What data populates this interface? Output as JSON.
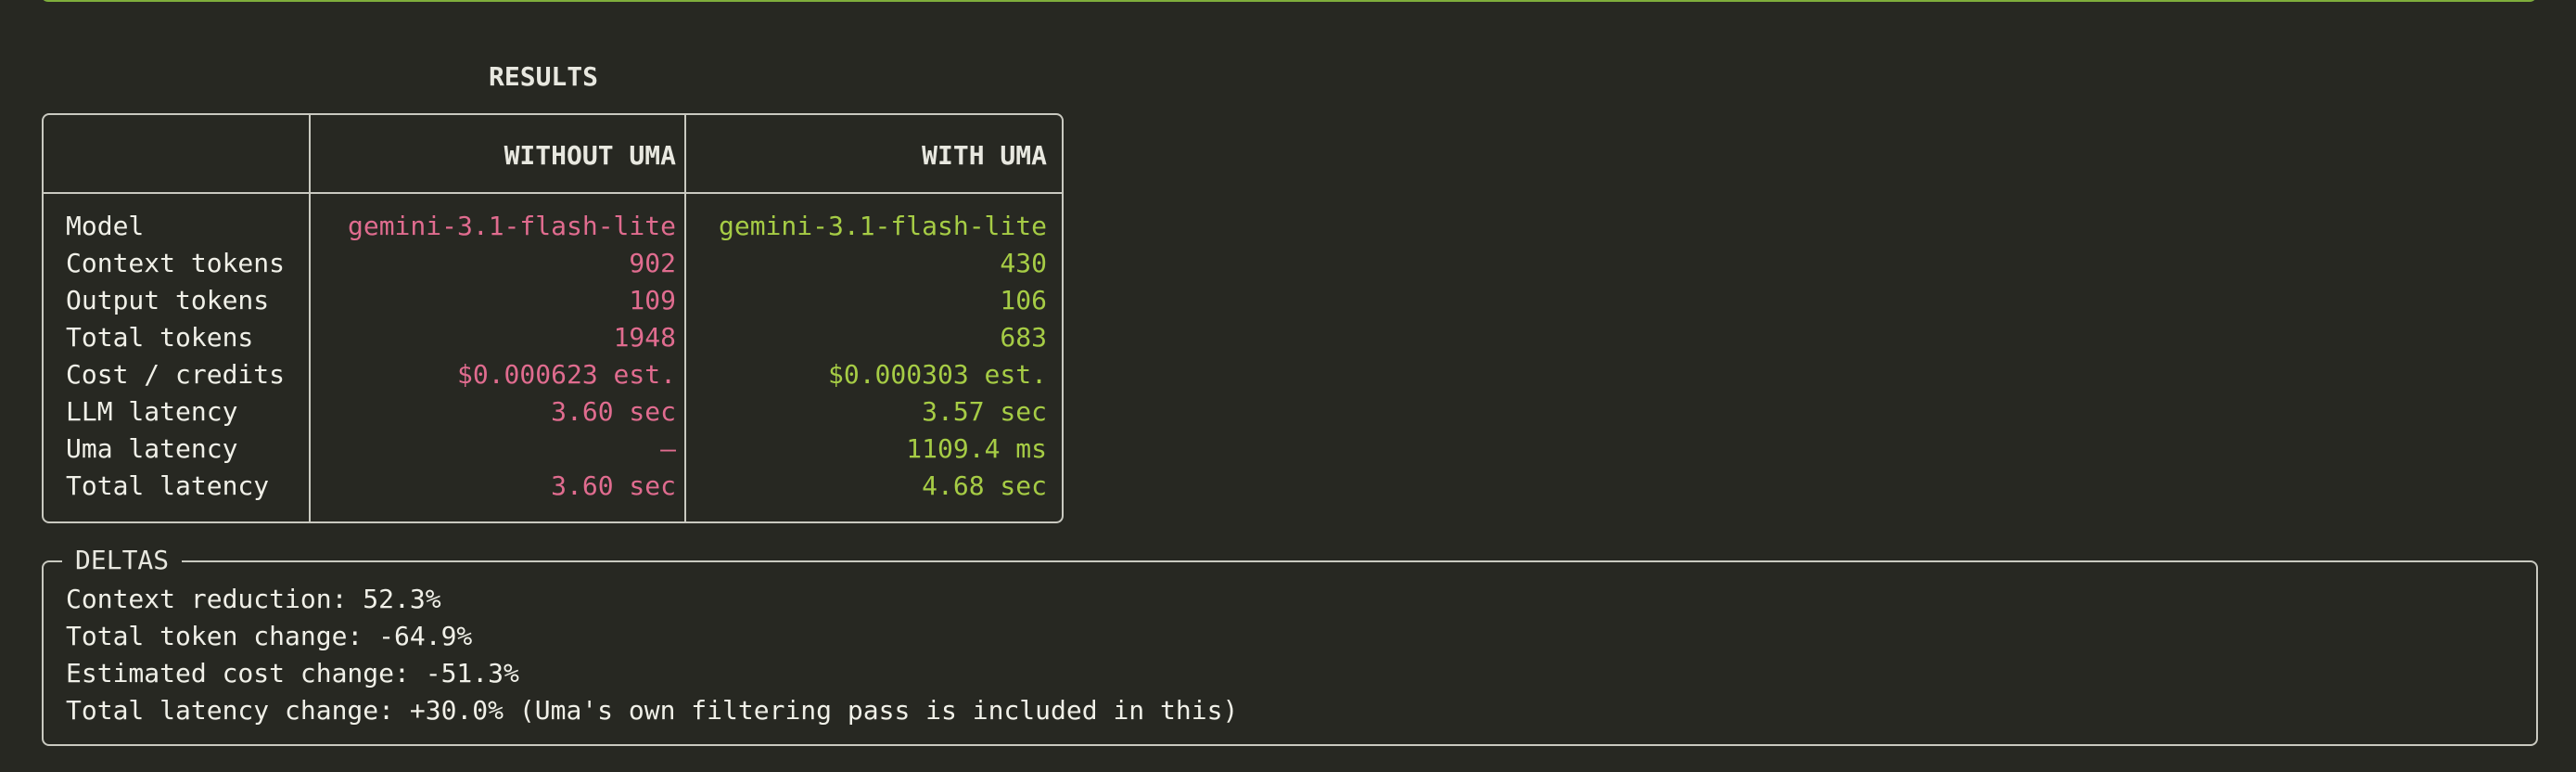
{
  "results": {
    "title": "RESULTS",
    "columns": [
      "",
      "WITHOUT UMA",
      "WITH UMA"
    ],
    "rows": [
      {
        "label": "Model",
        "without": "gemini-3.1-flash-lite",
        "with": "gemini-3.1-flash-lite"
      },
      {
        "label": "Context tokens",
        "without": "902",
        "with": "430"
      },
      {
        "label": "Output tokens",
        "without": "109",
        "with": "106"
      },
      {
        "label": "Total tokens",
        "without": "1948",
        "with": "683"
      },
      {
        "label": "Cost / credits",
        "without": "$0.000623 est.",
        "with": "$0.000303 est."
      },
      {
        "label": "LLM latency",
        "without": "3.60 sec",
        "with": "3.57 sec"
      },
      {
        "label": "Uma latency",
        "without": "—",
        "with": "1109.4 ms"
      },
      {
        "label": "Total latency",
        "without": "3.60 sec",
        "with": "4.68 sec"
      }
    ]
  },
  "deltas": {
    "title": "DELTAS",
    "lines": [
      "Context reduction: 52.3%",
      "Total token change: -64.9%",
      "Estimated cost change: -51.3%",
      "Total latency change: +30.0% (Uma's own filtering pass is included in this)"
    ]
  },
  "colors": {
    "background": "#272822",
    "without_uma": "#e06c8f",
    "with_uma": "#a6cc45",
    "border": "#c9c9c0",
    "top_rule": "#7fae3c"
  }
}
